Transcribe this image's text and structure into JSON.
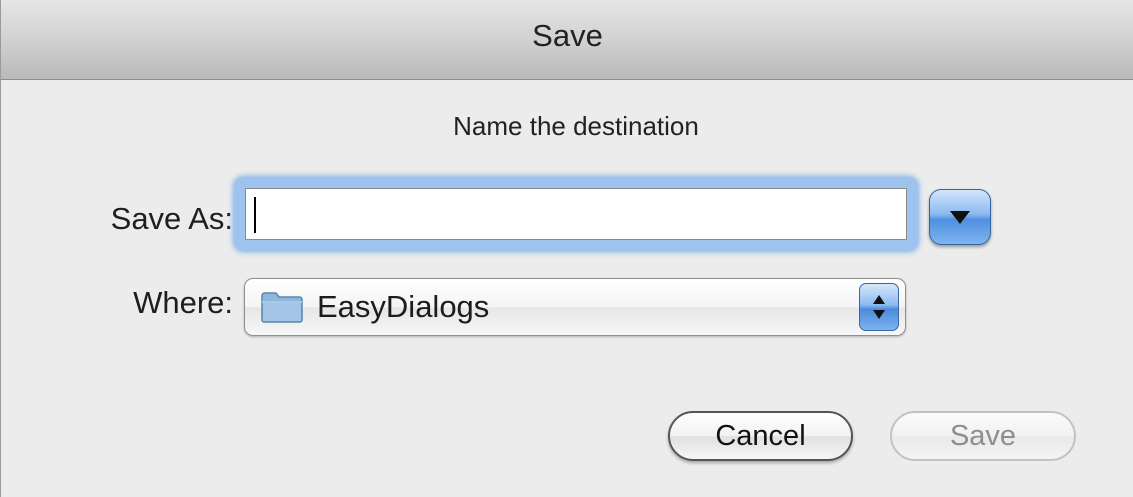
{
  "window": {
    "title": "Save"
  },
  "dialog": {
    "prompt": "Name the destination",
    "save_as_label": "Save As:",
    "save_as_value": "",
    "where_label": "Where:",
    "where_value": "EasyDialogs"
  },
  "buttons": {
    "cancel_label": "Cancel",
    "save_label": "Save",
    "save_enabled": false
  },
  "icons": {
    "disclosure": "triangle-down-icon",
    "folder": "folder-icon",
    "stepper": "up-down-arrows-icon"
  },
  "colors": {
    "accent": "#4f8fe0",
    "focus_ring": "#7fb0e8",
    "disabled_text": "#8e8e8e"
  }
}
